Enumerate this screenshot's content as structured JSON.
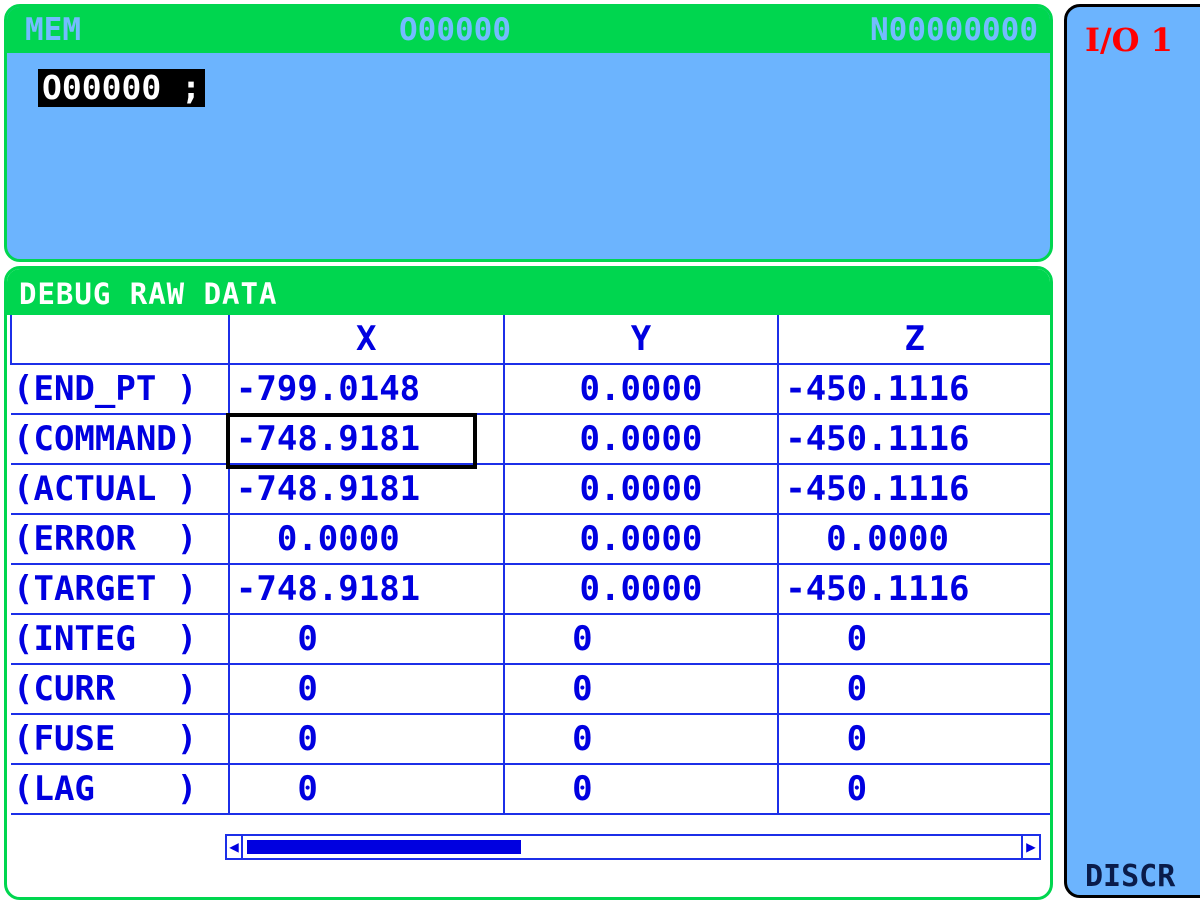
{
  "program_panel": {
    "mode": "MEM",
    "program_number": "O00000",
    "sequence_number": "N00000000",
    "current_line": "O00000 ;"
  },
  "side_panel": {
    "io_label": "I/O 1",
    "bottom_label": "DISCR"
  },
  "debug": {
    "title": "DEBUG RAW DATA",
    "columns": [
      "",
      "X",
      "Y",
      "Z"
    ],
    "rows": [
      {
        "label": "(END_PT )",
        "x": "-799.0148",
        "y": "0.0000",
        "z": "-450.1116"
      },
      {
        "label": "(COMMAND)",
        "x": "-748.9181",
        "y": "0.0000",
        "z": "-450.1116"
      },
      {
        "label": "(ACTUAL )",
        "x": "-748.9181",
        "y": "0.0000",
        "z": "-450.1116"
      },
      {
        "label": "(ERROR  )",
        "x": "  0.0000",
        "y": "0.0000",
        "z": "  0.0000"
      },
      {
        "label": "(TARGET )",
        "x": "-748.9181",
        "y": "0.0000",
        "z": "-450.1116"
      },
      {
        "label": "(INTEG  )",
        "x": "   0",
        "y": "   0",
        "z": "   0"
      },
      {
        "label": "(CURR   )",
        "x": "   0",
        "y": "   0",
        "z": "   0"
      },
      {
        "label": "(FUSE   )",
        "x": "   0",
        "y": "   0",
        "z": "   0"
      },
      {
        "label": "(LAG    )",
        "x": "   0",
        "y": "   0",
        "z": "   0"
      }
    ],
    "selected_cell": "COMMAND-X",
    "scroll_position": 0.34
  },
  "colors": {
    "header_green": "#00d64f",
    "panel_blue": "#6cb4fe",
    "text_blue": "#0000e0",
    "io_red": "#ff0000"
  }
}
